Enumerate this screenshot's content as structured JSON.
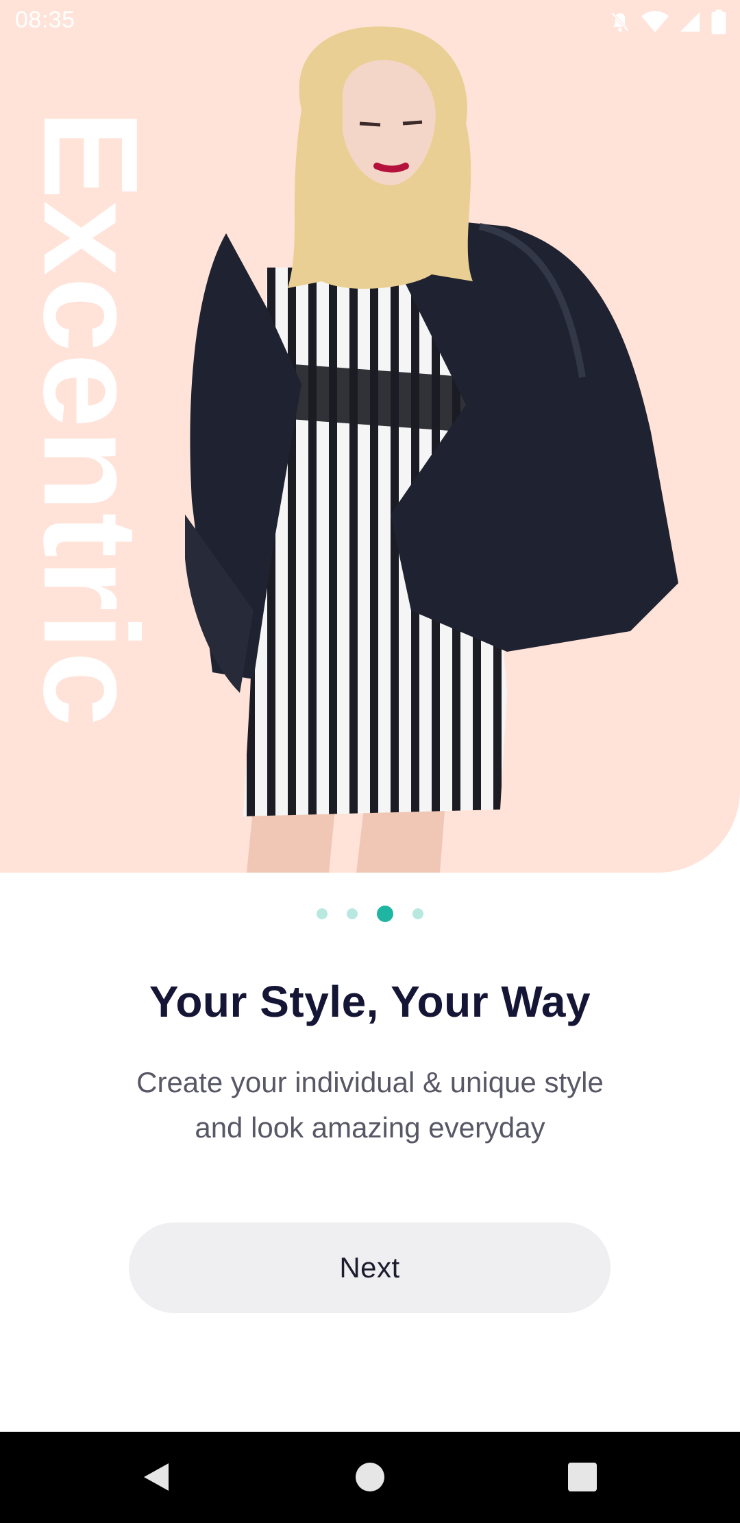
{
  "status_bar": {
    "time": "08:35",
    "icons": [
      "mute-icon",
      "wifi-icon",
      "signal-icon",
      "battery-icon"
    ]
  },
  "hero": {
    "brand_text": "Excentric",
    "background_color": "#ffe3d9"
  },
  "onboarding": {
    "page_indicator": {
      "total": 4,
      "active_index": 2
    },
    "title": "Your Style, Your Way",
    "subtitle_line1": "Create your individual & unique style",
    "subtitle_line2": "and look amazing everyday",
    "next_label": "Next"
  },
  "colors": {
    "accent": "#1fb5a3",
    "dot_inactive": "#b9e8e1",
    "title": "#151535",
    "subtitle": "#575766",
    "button_bg": "#efeff1"
  },
  "nav_bar": {
    "icons": [
      "back-icon",
      "home-icon",
      "recents-icon"
    ]
  }
}
